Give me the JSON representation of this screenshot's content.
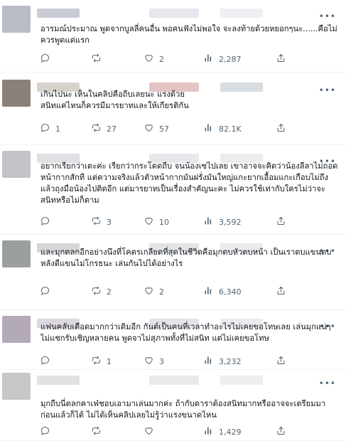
{
  "replies": [
    {
      "text": "อารมณ์ประมาณ  พูดจากบูลลี่คนอื่น  พอคนฟังไม่พอใจ จะลงท้ายด้วยหยอกๆนะ......คือไม่ควรพูดแต่แรก",
      "replies": "",
      "reposts": "",
      "likes": "2",
      "views": "2,287",
      "avatar_color": "#b8bcc6",
      "blur_colors": [
        "#c9ccd6",
        "#e6e8ee",
        "#eeeff3"
      ]
    },
    {
      "text": "เกินไปนะ เห็นในคลิปคือถีบเลยนะ แรงด้วย\nสนิทแค่ไหนก็ควรมีมารยาทและให้เกียรติกัน",
      "replies": "1",
      "reposts": "27",
      "likes": "57",
      "views": "82.1K",
      "avatar_color": "#8a8079",
      "blur_colors": [
        "#d8d2cc",
        "#e4c4c4",
        "#d8dde2"
      ]
    },
    {
      "text": "อยากเรียกว่าเตะค่ะ เรียกว่ากระโดดถีบ จนน้องเซไปเลย เขาอาจจะคิดว่าน้องลีลาไม่ถอดหน้ากากสักที แต่ความจริงแล้วตัวหน้ากากมันฝรั่งมันใหญ่แกะยากเอื้อมแกะเกือบไม่ถึงแล้วถุงมือน้องไปติดอีก แต่มารยาทเป็นเรื่องสำคัญนะคะ ไม่ควรใช้เท่ากับใครไม่ว่าจะสนิทหรือไม่ก็ตาม",
      "replies": "",
      "reposts": "3",
      "likes": "10",
      "views": "3,592",
      "avatar_color": "#c4c4c8",
      "blur_colors": [
        "#e0e0e4",
        "#e8e8ec",
        "#ececef"
      ]
    },
    {
      "text": "และมุกตลกอีกอย่างนึงที่โคตรเกลียดที่สุดในชีวิตคือมุกตบหัวตบหน้า เป็นเราตบแขนตบหลังดีแขนไม่โกรธนะ เล่นกันไปได้อย่างไร",
      "replies": "",
      "reposts": "2",
      "likes": "2",
      "views": "6,340",
      "avatar_color": "#9aa09c",
      "blur_colors": [
        "#d4d6d8",
        "#e2e4e6",
        "#eaebed"
      ]
    },
    {
      "text": "แฟนคลับเดือดมากกว่าเดิมอีก กันต์เป็นคนที่เวลาทำอะไรไม่เคยขอโทษเลย เล่นมุกแน่ๆไม่แชกรับเชิญหลายคน พูดจาไม่สุภาพทั้งที่ไม่สนิท แต่ไม่เคยขอโทษ",
      "replies": "",
      "reposts": "1",
      "likes": "3",
      "views": "3,232",
      "avatar_color": "#b3a9b8",
      "blur_colors": [
        "#ddd8e0",
        "#e6e3e8",
        "#ecebee"
      ]
    },
    {
      "text": "มุกถีบนี่ตลกคาเฟ่ชอบเอามาเล่นมากค่ะ  ถ้ากับดาราต้องสนิทมากหรืออาจจะเตรียมมาก่อนแล้วก็ได้  ไม่ได้เห็นคลิปเลยไม่รู้ว่าแรงขนาดไหน",
      "replies": "",
      "reposts": "",
      "likes": "",
      "views": "1,429",
      "avatar_color": "#c7c7c9",
      "blur_colors": [
        "#e2e2e4",
        "#e9e9eb",
        "#eeeef0"
      ]
    }
  ]
}
